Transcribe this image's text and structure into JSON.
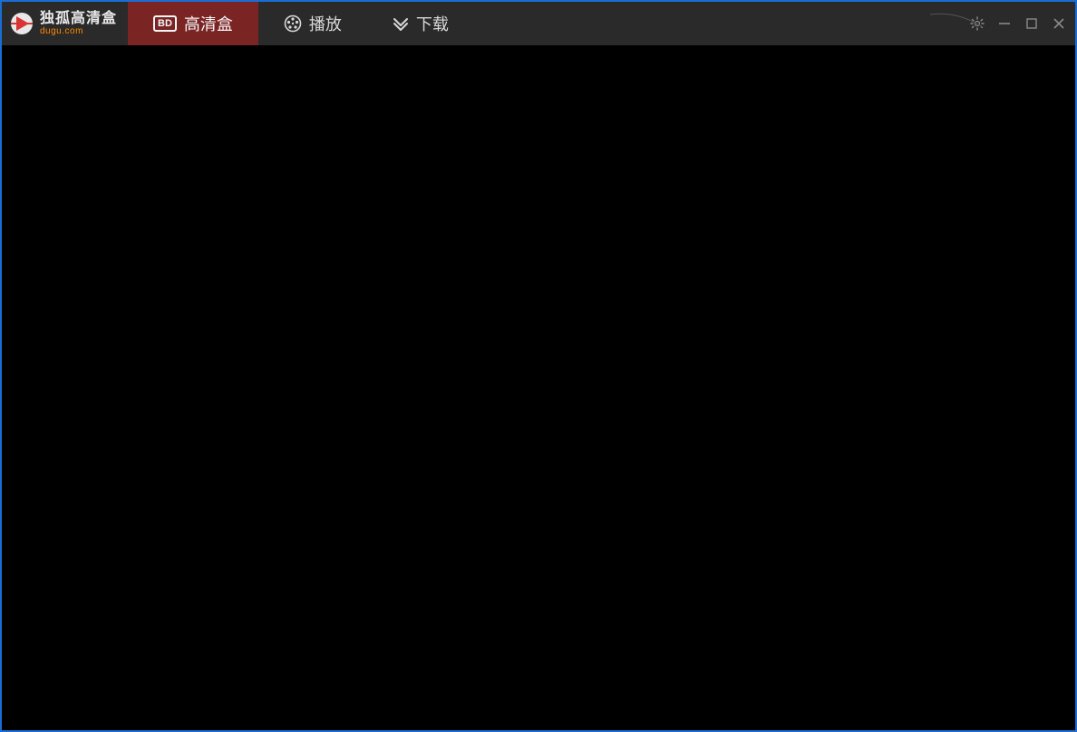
{
  "app": {
    "logo_title": "独孤高清盒",
    "logo_subtitle": "dugu.com"
  },
  "tabs": [
    {
      "icon": "bd",
      "label": "高清盒",
      "active": true
    },
    {
      "icon": "reel",
      "label": "播放",
      "active": false
    },
    {
      "icon": "download",
      "label": "下载",
      "active": false
    }
  ],
  "icons": {
    "bd_text": "BD"
  },
  "window_controls": {
    "settings": "settings",
    "minimize": "minimize",
    "maximize": "maximize",
    "close": "close"
  }
}
